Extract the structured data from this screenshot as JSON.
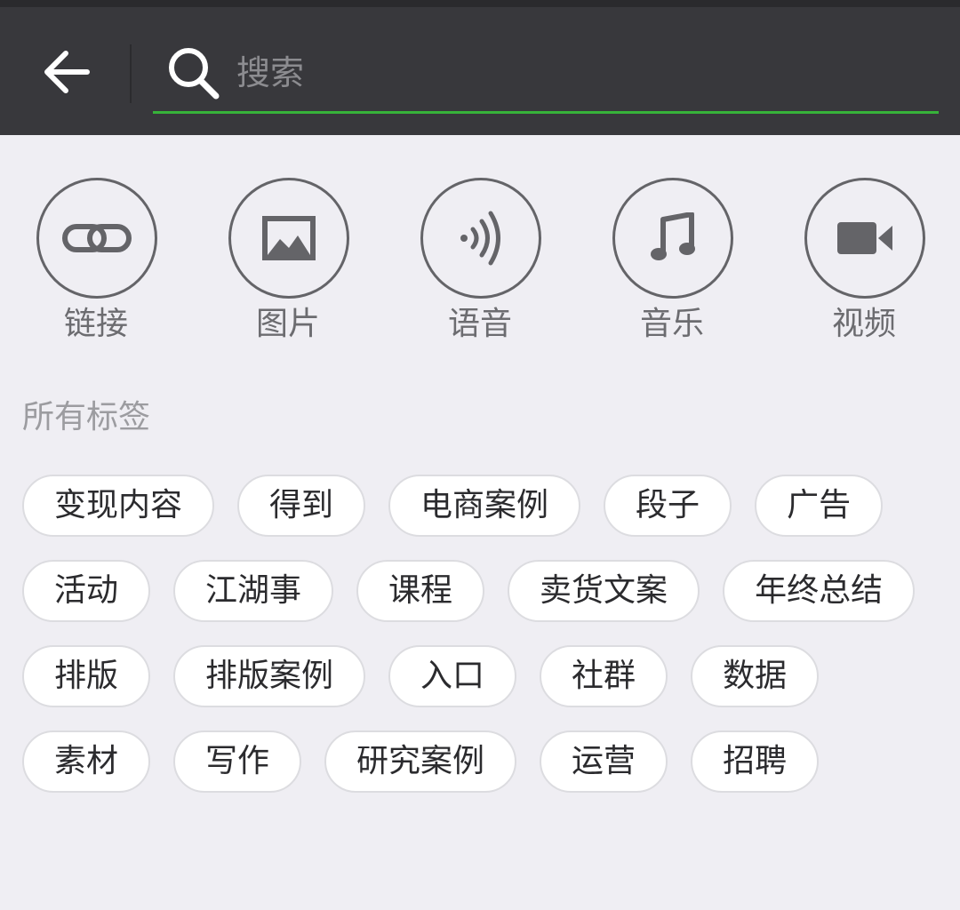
{
  "search": {
    "placeholder": "搜索",
    "value": "",
    "accent_color": "#37b33a"
  },
  "header": {
    "back_icon": "arrow-left-icon",
    "background_color": "#38383c"
  },
  "categories": [
    {
      "label": "链接",
      "icon": "link-icon"
    },
    {
      "label": "图片",
      "icon": "image-icon"
    },
    {
      "label": "语音",
      "icon": "voice-icon"
    },
    {
      "label": "音乐",
      "icon": "music-note-icon"
    },
    {
      "label": "视频",
      "icon": "video-camera-icon"
    }
  ],
  "tags_section": {
    "title": "所有标签",
    "tags": [
      "变现内容",
      "得到",
      "电商案例",
      "段子",
      "广告",
      "活动",
      "江湖事",
      "课程",
      "卖货文案",
      "年终总结",
      "排版",
      "排版案例",
      "入口",
      "社群",
      "数据",
      "素材",
      "写作",
      "研究案例",
      "运营",
      "招聘"
    ]
  }
}
